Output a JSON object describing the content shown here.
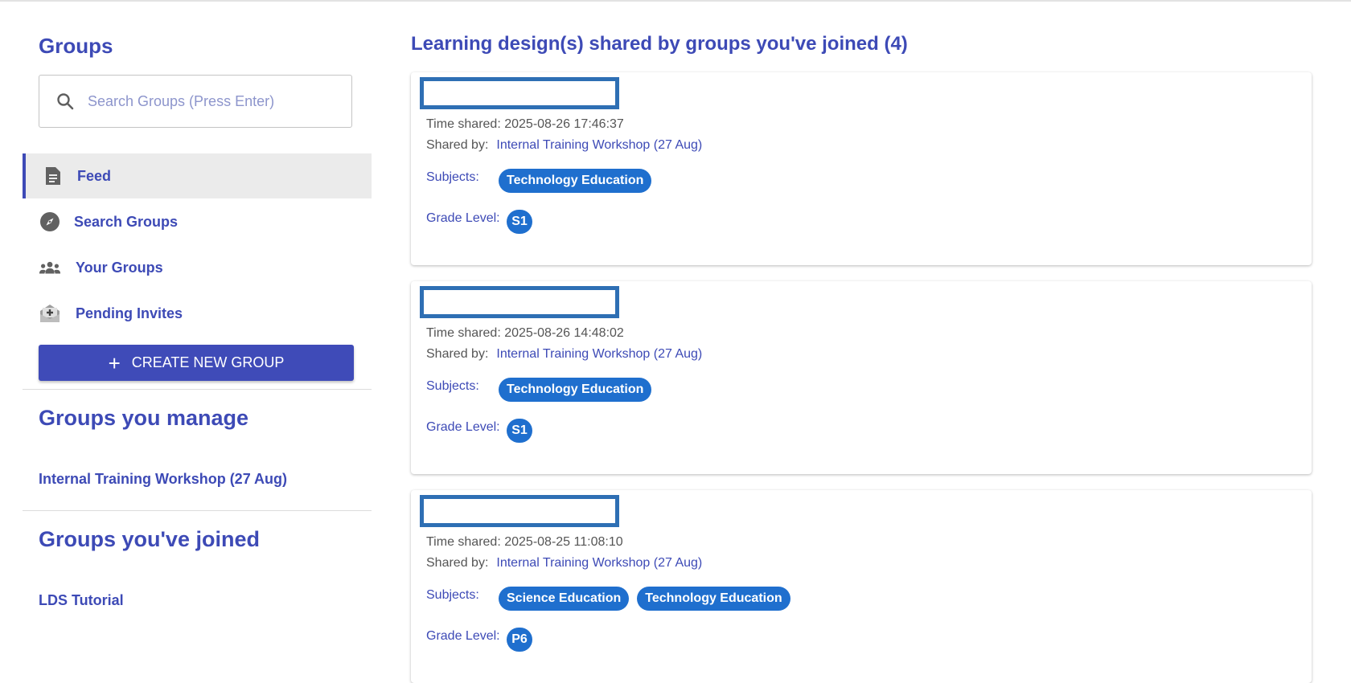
{
  "sidebar": {
    "title": "Groups",
    "search": {
      "placeholder": "Search Groups (Press Enter)",
      "value": ""
    },
    "nav": [
      {
        "label": "Feed",
        "icon": "feed-icon",
        "active": true
      },
      {
        "label": "Search Groups",
        "icon": "compass-icon",
        "active": false
      },
      {
        "label": "Your Groups",
        "icon": "groups-icon",
        "active": false
      },
      {
        "label": "Pending Invites",
        "icon": "invite-icon",
        "active": false
      }
    ],
    "create_button": {
      "icon": "+",
      "label": "CREATE NEW GROUP"
    },
    "manage": {
      "title": "Groups you manage",
      "items": [
        "Internal Training Workshop (27 Aug)"
      ]
    },
    "joined": {
      "title": "Groups you've joined",
      "items": [
        "LDS Tutorial"
      ]
    }
  },
  "main": {
    "title": "Learning design(s) shared by groups you've joined (4)",
    "cards": [
      {
        "time_label": "Time shared:",
        "time": "2025-08-26 17:46:37",
        "shared_label": "Shared by:",
        "shared_by": "Internal Training Workshop (27 Aug)",
        "subjects_label": "Subjects:",
        "subjects": [
          "Technology Education"
        ],
        "grade_label": "Grade Level:",
        "grade": "S1"
      },
      {
        "time_label": "Time shared:",
        "time": "2025-08-26 14:48:02",
        "shared_label": "Shared by:",
        "shared_by": "Internal Training Workshop (27 Aug)",
        "subjects_label": "Subjects:",
        "subjects": [
          "Technology Education"
        ],
        "grade_label": "Grade Level:",
        "grade": "S1"
      },
      {
        "time_label": "Time shared:",
        "time": "2025-08-25 11:08:10",
        "shared_label": "Shared by:",
        "shared_by": "Internal Training Workshop (27 Aug)",
        "subjects_label": "Subjects:",
        "subjects": [
          "Science Education",
          "Technology Education"
        ],
        "grade_label": "Grade Level:",
        "grade": "P6"
      }
    ]
  },
  "colors": {
    "accent": "#3d4ab6",
    "chip": "#1f6fce",
    "redaction_border": "#2e6fb4",
    "active_nav_bg": "#ebebeb"
  }
}
